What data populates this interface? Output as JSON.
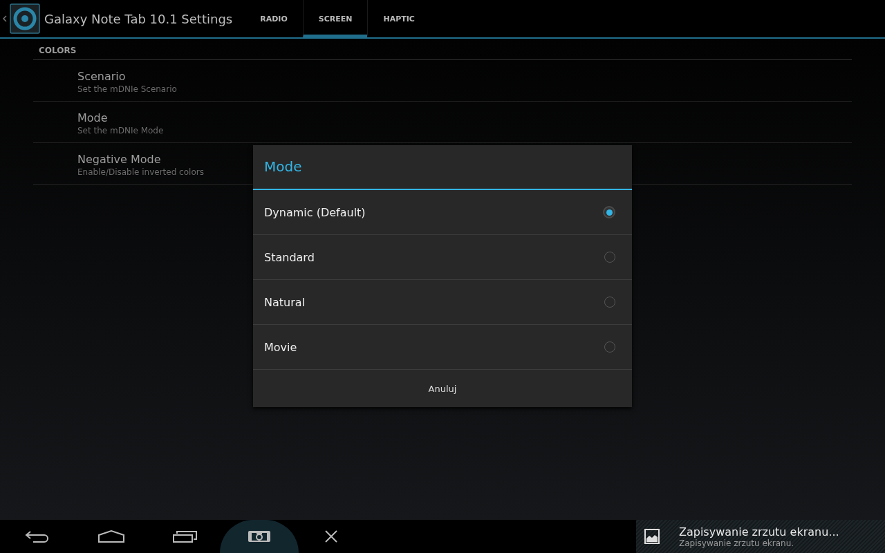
{
  "action_bar": {
    "title": "Galaxy Note Tab 10.1 Settings"
  },
  "tabs": [
    {
      "label": "RADIO",
      "selected": false
    },
    {
      "label": "SCREEN",
      "selected": true
    },
    {
      "label": "HAPTIC",
      "selected": false
    }
  ],
  "section": {
    "header": "COLORS",
    "items": [
      {
        "title": "Scenario",
        "summary": "Set the mDNIe Scenario"
      },
      {
        "title": "Mode",
        "summary": "Set the mDNIe Mode"
      },
      {
        "title": "Negative Mode",
        "summary": "Enable/Disable inverted colors"
      }
    ]
  },
  "dialog": {
    "title": "Mode",
    "options": [
      {
        "label": "Dynamic (Default)",
        "selected": true
      },
      {
        "label": "Standard",
        "selected": false
      },
      {
        "label": "Natural",
        "selected": false
      },
      {
        "label": "Movie",
        "selected": false
      }
    ],
    "cancel": "Anuluj"
  },
  "notification": {
    "title": "Zapisywanie zrzutu ekranu...",
    "text": "Zapisywanie zrzutu ekranu."
  }
}
